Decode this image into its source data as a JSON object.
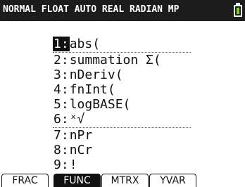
{
  "status_bar": {
    "text": "NORMAL FLOAT AUTO REAL RADIAN MP",
    "battery_color": "#7ed321"
  },
  "menu": {
    "items": [
      {
        "num": "1:",
        "label": "abs(",
        "selected": true
      },
      {
        "num": "2:",
        "label": "summation Σ(",
        "selected": false
      },
      {
        "num": "3:",
        "label": "nDeriv(",
        "selected": false
      },
      {
        "num": "4:",
        "label": "fnInt(",
        "selected": false
      },
      {
        "num": "5:",
        "label": "logBASE(",
        "selected": false
      },
      {
        "num": "6:",
        "label": "ˣ√",
        "selected": false
      },
      {
        "num": "7:",
        "label": "nPr",
        "selected": false
      },
      {
        "num": "8:",
        "label": "nCr",
        "selected": false
      },
      {
        "num": "9:",
        "label": "!",
        "selected": false
      }
    ]
  },
  "softkeys": [
    {
      "label": "FRAC",
      "active": false
    },
    {
      "label": "FUNC",
      "active": true
    },
    {
      "label": "MTRX",
      "active": false
    },
    {
      "label": "YVAR",
      "active": false
    }
  ]
}
